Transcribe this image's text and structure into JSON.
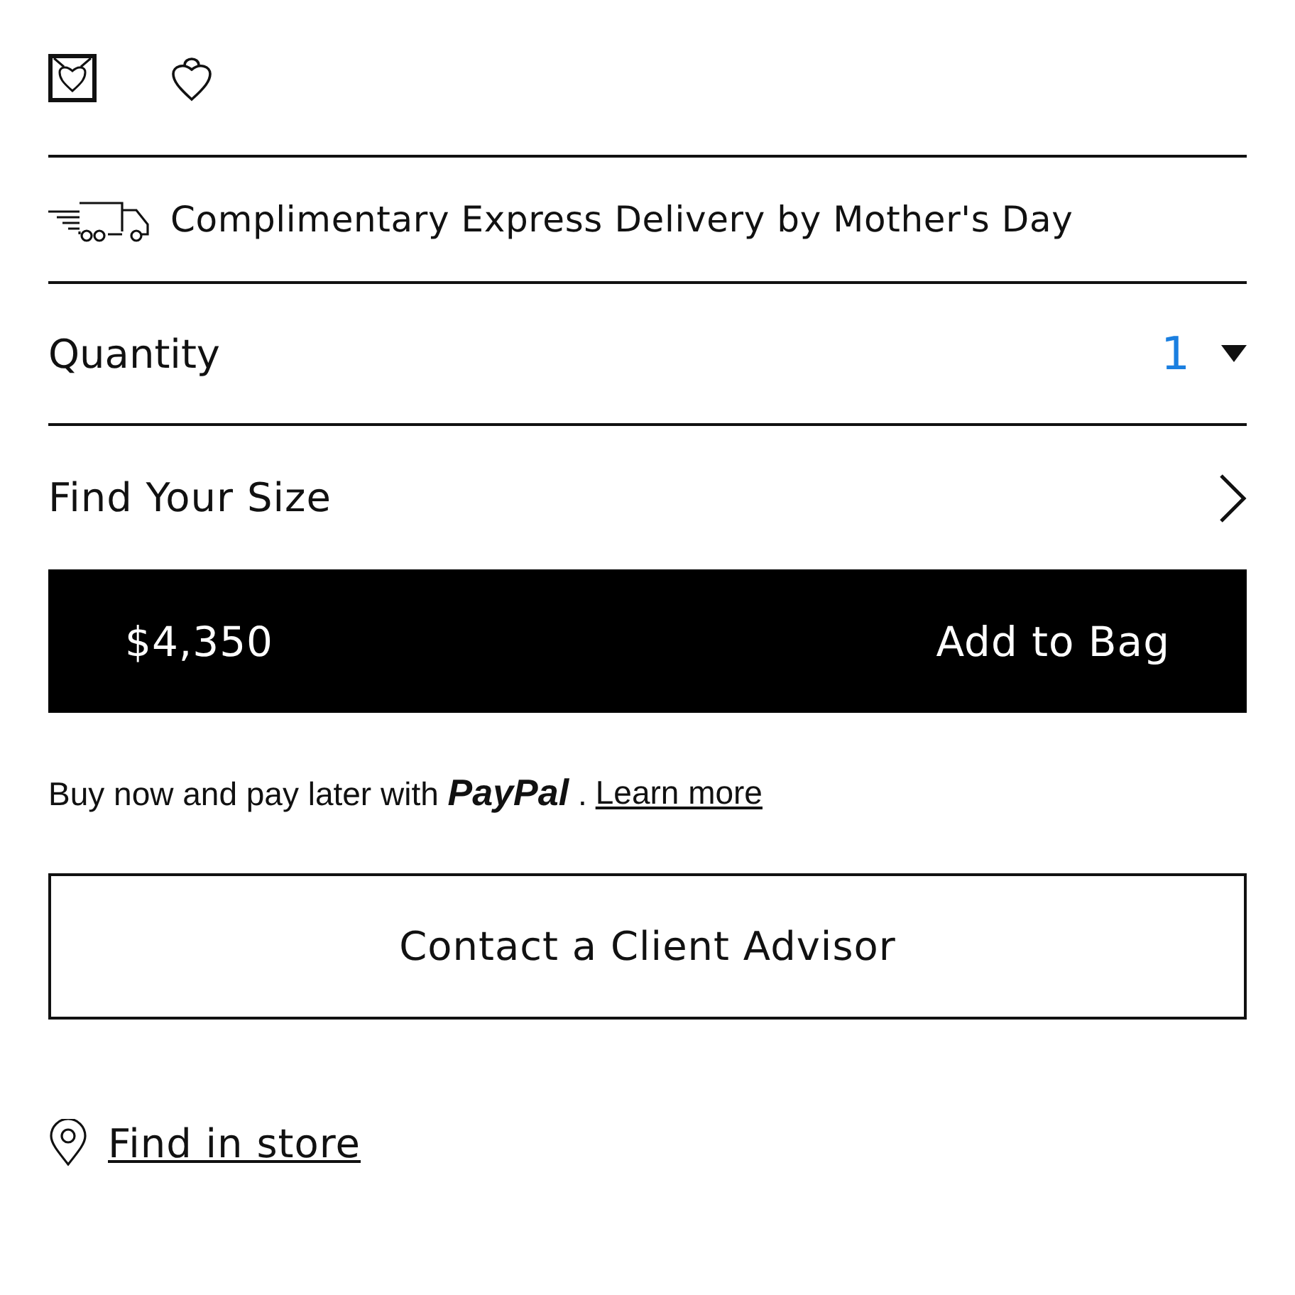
{
  "actions": [
    {
      "kind": "gift"
    },
    {
      "kind": "wishlist"
    }
  ],
  "delivery": {
    "text": "Complimentary Express Delivery by Mother's Day"
  },
  "quantity": {
    "label": "Quantity",
    "value": "1"
  },
  "size": {
    "label": "Find Your Size"
  },
  "add_to_bag": {
    "price": "$4,350",
    "label": "Add to Bag"
  },
  "paypal": {
    "text": "Buy now and pay later with **PayPal** .",
    "link": "Learn more"
  },
  "contact": {
    "label": "Contact a Client Advisor"
  },
  "store": {
    "label": "Find in store"
  }
}
